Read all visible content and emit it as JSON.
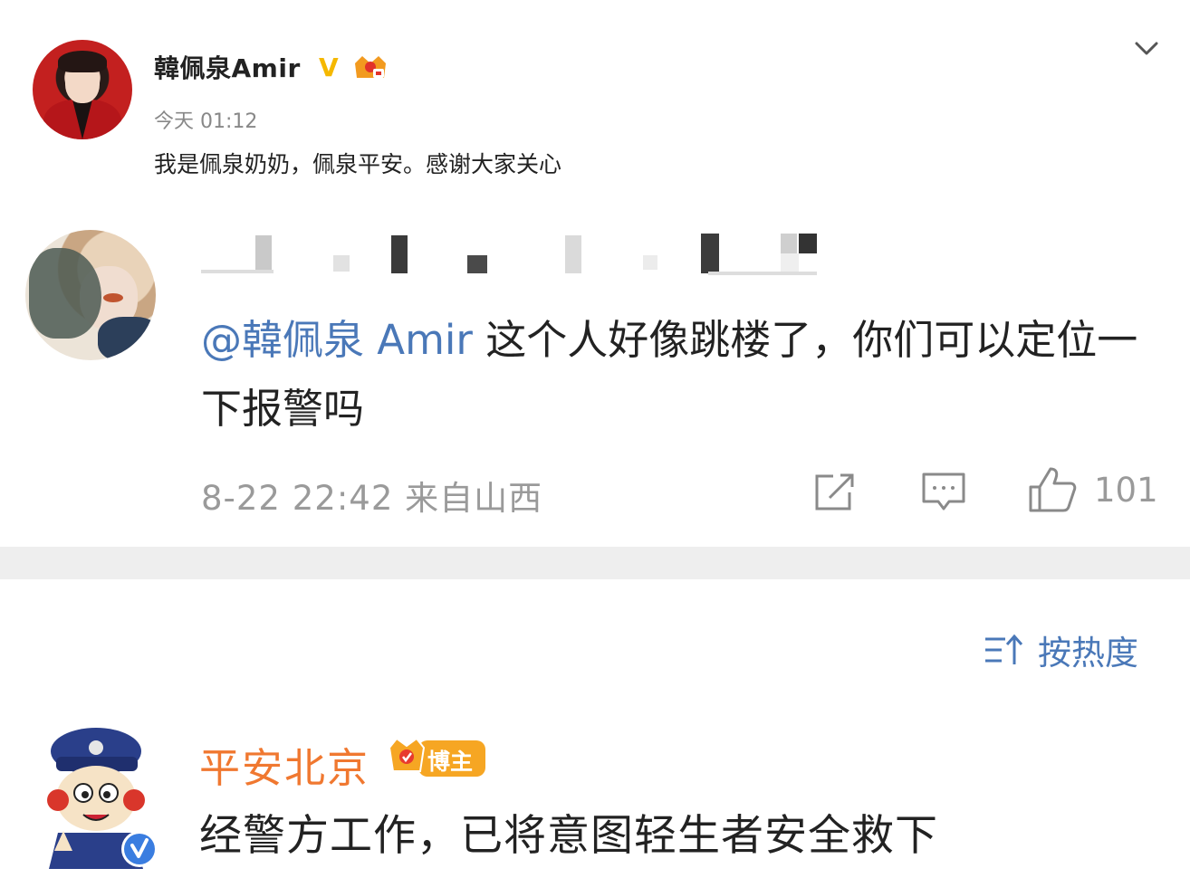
{
  "post": {
    "username": "韓佩泉Amir",
    "verified_mark": "V",
    "time": "今天 01:12",
    "text": "我是佩泉奶奶，佩泉平安。感谢大家关心"
  },
  "reply": {
    "mention": "@韓佩泉 Amir",
    "body": " 这个人好像跳楼了，你们可以定位一下报警吗",
    "meta": "8-22 22:42 来自山西",
    "likes": "101"
  },
  "sort": {
    "label": "按热度"
  },
  "official_comment": {
    "name": "平安北京",
    "badge_label": "博主",
    "text": "经警方工作，已将意图轻生者安全救下"
  },
  "colors": {
    "link_blue": "#4a78b8",
    "orange_name": "#f07830",
    "badge_orange": "#f6a623",
    "meta_gray": "#9a9a9a",
    "verified_gold": "#f5b800"
  },
  "icons": [
    "chevron-down-icon",
    "share-icon",
    "comment-icon",
    "like-icon",
    "sort-icon",
    "verified-icon",
    "crown-icon"
  ]
}
